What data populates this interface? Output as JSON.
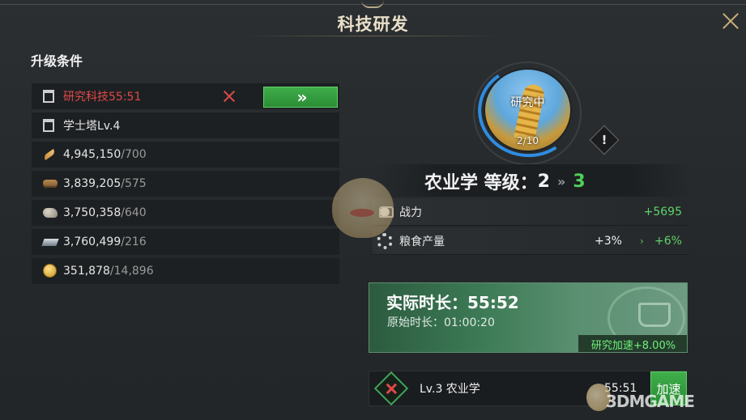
{
  "window": {
    "title": "科技研发",
    "close_icon": "close-icon"
  },
  "requirements": {
    "heading": "升级条件",
    "research": {
      "text": "研究科技55:51",
      "color": "#e04848",
      "go_label": "»"
    },
    "tower": {
      "text": "学士塔Lv.4"
    },
    "resources": [
      {
        "icon": "feather-icon",
        "have": "4,945,150",
        "need": "/700"
      },
      {
        "icon": "wood-icon",
        "have": "3,839,205",
        "need": "/575"
      },
      {
        "icon": "stone-icon",
        "have": "3,750,358",
        "need": "/640"
      },
      {
        "icon": "iron-icon",
        "have": "3,760,499",
        "need": "/216"
      },
      {
        "icon": "gold-coin-icon",
        "have": "351,878",
        "need": "/14,896"
      }
    ]
  },
  "tech": {
    "status": "研究中",
    "progress": "2/10",
    "progress_value": 0.2,
    "name_level_label": "农业学 等级：",
    "current_level": "2",
    "arrow": "»",
    "next_level": "3",
    "warn_symbol": "!"
  },
  "stats": [
    {
      "icon": "fist-icon",
      "label": "战力",
      "current": "",
      "arrow": "",
      "value": "+5695"
    },
    {
      "icon": "gear-icon",
      "label": "粮食产量",
      "current": "+3%",
      "arrow": "›",
      "value": "+6%"
    }
  ],
  "time": {
    "actual": "实际时长：55:52",
    "original": "原始时长：01:00:20",
    "boost": "研究加速+8.00%"
  },
  "queue": {
    "label": "Lv.3 农业学",
    "time": "55:51",
    "speed_label": "加速"
  },
  "watermark": {
    "text": "3DMGAME"
  },
  "colors": {
    "accent_green": "#4fcf5a",
    "alert_red": "#e04848",
    "gold": "#c9b07a"
  }
}
